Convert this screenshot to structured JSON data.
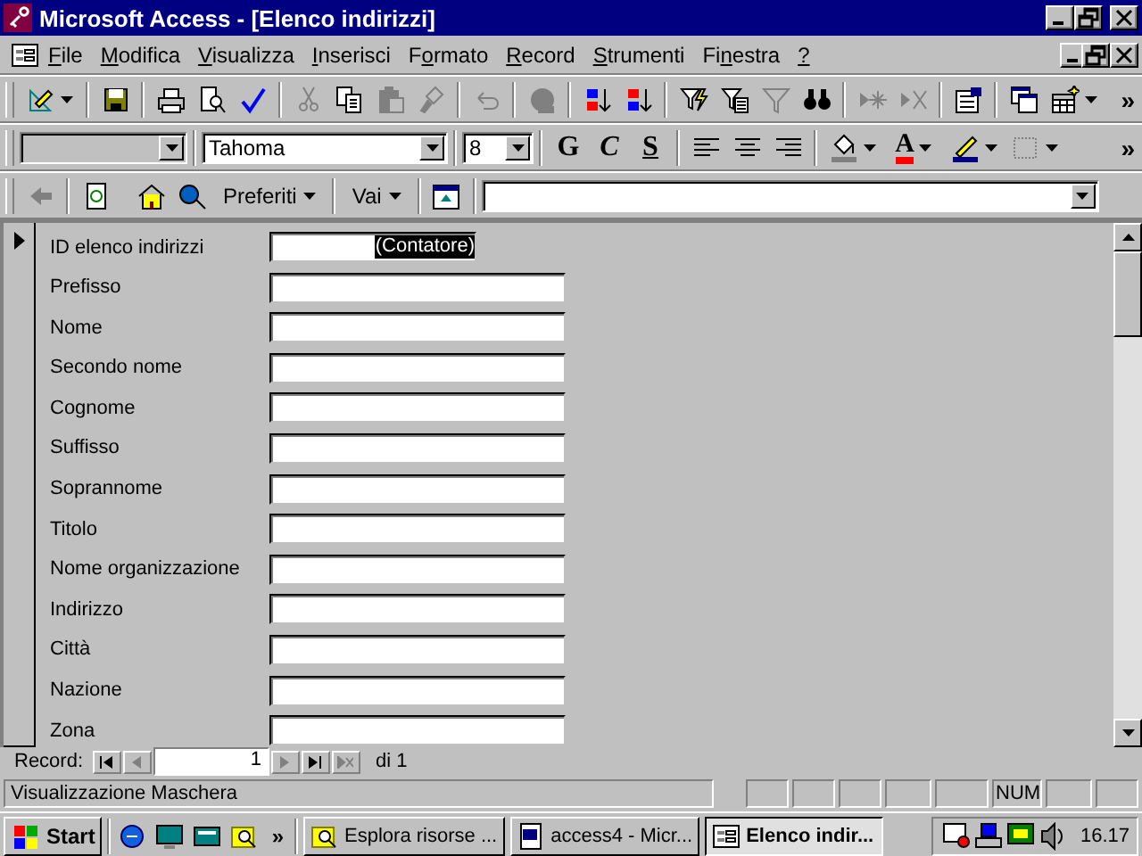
{
  "window": {
    "title": "Microsoft Access - [Elenco indirizzi]"
  },
  "menu": [
    {
      "key": "F",
      "post": "ile"
    },
    {
      "key": "M",
      "post": "odifica"
    },
    {
      "key": "V",
      "post": "isualizza"
    },
    {
      "key": "I",
      "post": "nserisci"
    },
    {
      "pre": "F",
      "key": "o",
      "post": "rmato"
    },
    {
      "key": "R",
      "post": "ecord"
    },
    {
      "key": "S",
      "post": "trumenti"
    },
    {
      "pre": "Fi",
      "key": "n",
      "post": "estra"
    },
    {
      "key": "?"
    }
  ],
  "standard_toolbar": {
    "buttons": [
      {
        "disabled": false
      },
      {
        "disabled": false
      },
      {
        "disabled": false
      },
      {
        "disabled": false
      },
      {
        "disabled": false
      },
      {
        "disabled": true
      },
      {
        "disabled": false
      },
      {
        "disabled": true
      },
      {
        "disabled": true
      },
      {
        "disabled": true
      },
      {
        "disabled": true
      },
      {
        "disabled": false
      },
      {
        "disabled": false
      },
      {
        "disabled": false
      },
      {
        "disabled": false
      },
      {
        "disabled": true
      },
      {
        "disabled": false
      },
      {
        "disabled": true
      },
      {
        "disabled": true
      },
      {
        "disabled": false
      },
      {
        "disabled": false
      },
      {
        "disabled": false
      }
    ],
    "overflow": "»"
  },
  "format_toolbar": {
    "font": "Tahoma",
    "size": "8",
    "style_buttons": [
      "G",
      "C",
      "S"
    ],
    "font_color_label": "A",
    "overflow": "»"
  },
  "web_toolbar": {
    "back_disabled": true,
    "favorites": "Preferiti",
    "go": "Vai"
  },
  "form": {
    "fields": [
      {
        "label": "ID elenco indirizzi",
        "value": "(Contatore)",
        "value_selected": true
      },
      {
        "label": "Prefisso"
      },
      {
        "label": "Nome"
      },
      {
        "label": "Secondo nome"
      },
      {
        "label": "Cognome"
      },
      {
        "label": "Suffisso"
      },
      {
        "label": "Soprannome"
      },
      {
        "label": "Titolo"
      },
      {
        "label": "Nome organizzazione"
      },
      {
        "label": "Indirizzo"
      },
      {
        "label": "Città"
      },
      {
        "label": "Nazione"
      },
      {
        "label": "Zona"
      }
    ]
  },
  "record_nav": {
    "label": "Record:",
    "current": "1",
    "total": "di 1"
  },
  "status_bar": {
    "message": "Visualizzazione Maschera",
    "num": "NUM"
  },
  "taskbar": {
    "start": "Start",
    "more": "»",
    "tasks": [
      {
        "label": "Esplora risorse ...",
        "selected": false
      },
      {
        "label": "access4 - Micr...",
        "selected": false
      },
      {
        "label": "Elenco indir...",
        "selected": true
      }
    ],
    "clock": "16.17"
  }
}
